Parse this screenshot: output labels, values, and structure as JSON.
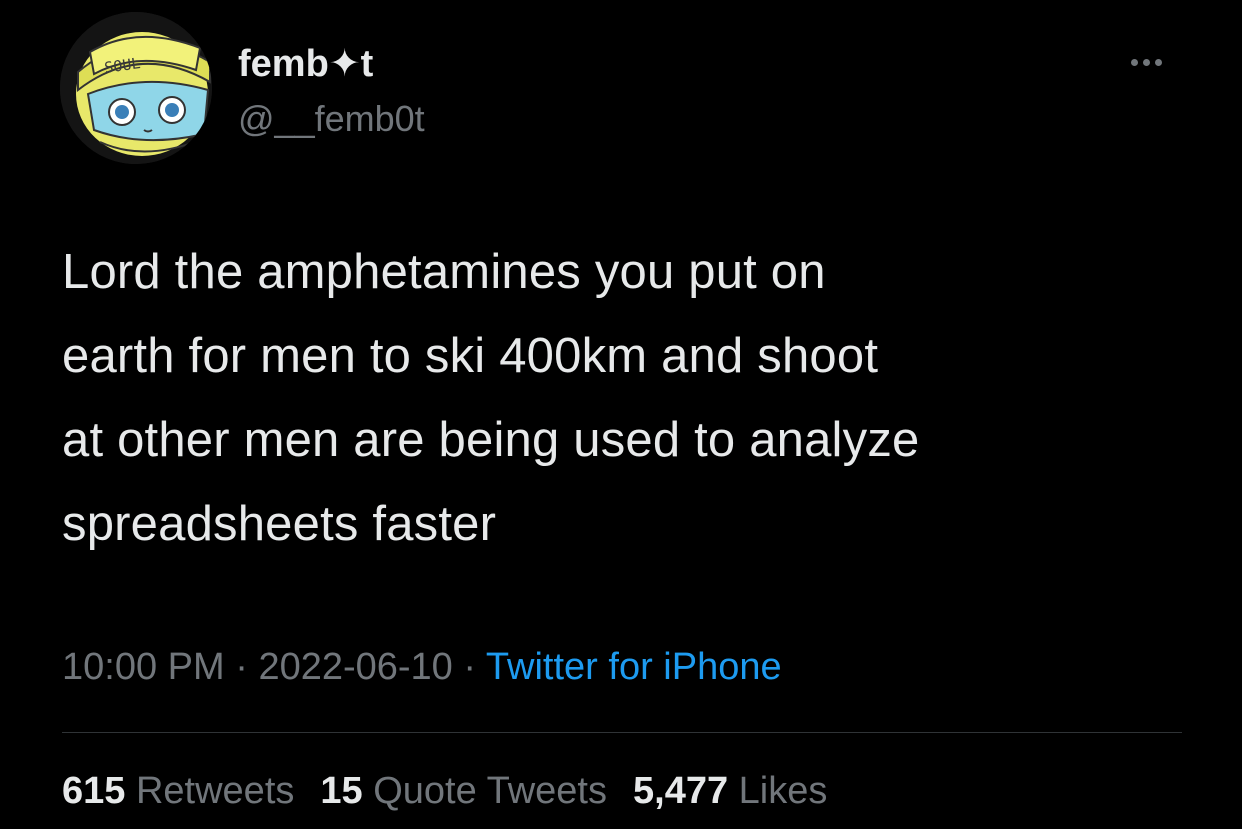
{
  "author": {
    "display_name": "femb✦t",
    "handle": "@__femb0t",
    "avatar_text": "SOUL"
  },
  "tweet": {
    "text": "Lord the amphetamines you put on\nearth for men to ski 400km and shoot\nat other men are being used to analyze\nspreadsheets faster"
  },
  "meta": {
    "time": "10:00 PM",
    "separator": " · ",
    "date": "2022-06-10",
    "source": "Twitter for iPhone"
  },
  "stats": {
    "retweets_count": "615",
    "retweets_label": "Retweets",
    "quotes_count": "15",
    "quotes_label": "Quote Tweets",
    "likes_count": "5,477",
    "likes_label": "Likes"
  },
  "colors": {
    "background": "#000000",
    "text_primary": "#e7e9ea",
    "text_secondary": "#71767b",
    "link": "#1d9bf0",
    "divider": "#2f3336"
  },
  "icons": {
    "more": "more-horizontal-icon"
  }
}
